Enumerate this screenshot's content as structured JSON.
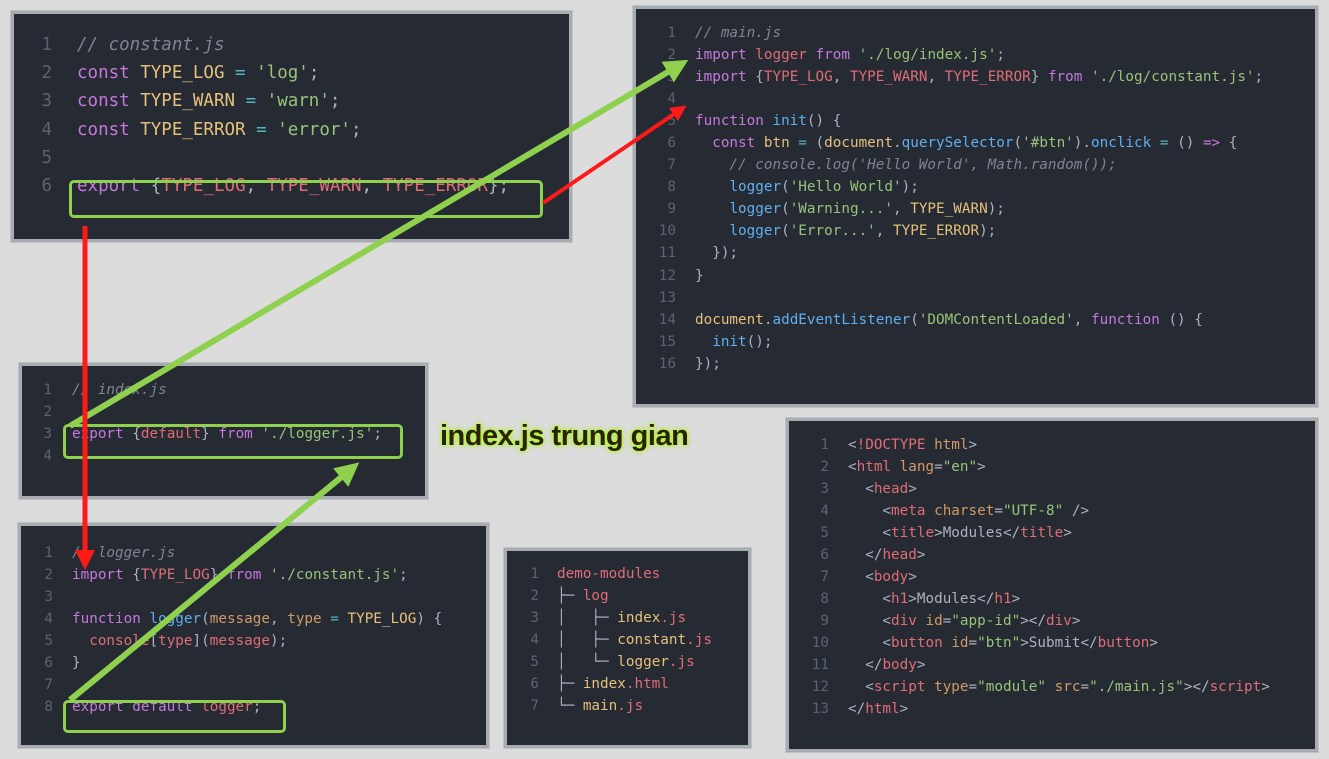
{
  "caption": "index.js trung gian",
  "colors": {
    "highlight": "#8fd14f",
    "green_arrow": "#8fd14f",
    "red_arrow": "#ff1a1a"
  },
  "constant_panel": {
    "lines": [
      [
        [
          "cm",
          "// constant.js"
        ]
      ],
      [
        [
          "kw",
          "const "
        ],
        [
          "var",
          "TYPE_LOG"
        ],
        [
          "op",
          " = "
        ],
        [
          "str",
          "'log'"
        ],
        [
          "pl",
          ";"
        ]
      ],
      [
        [
          "kw",
          "const "
        ],
        [
          "var",
          "TYPE_WARN"
        ],
        [
          "op",
          " = "
        ],
        [
          "str",
          "'warn'"
        ],
        [
          "pl",
          ";"
        ]
      ],
      [
        [
          "kw",
          "const "
        ],
        [
          "var",
          "TYPE_ERROR"
        ],
        [
          "op",
          " = "
        ],
        [
          "str",
          "'error'"
        ],
        [
          "pl",
          ";"
        ]
      ],
      [],
      [
        [
          "kw",
          "export "
        ],
        [
          "pl",
          "{"
        ],
        [
          "red",
          "TYPE_LOG"
        ],
        [
          "pl",
          ", "
        ],
        [
          "red",
          "TYPE_WARN"
        ],
        [
          "pl",
          ", "
        ],
        [
          "red",
          "TYPE_ERROR"
        ],
        [
          "pl",
          "};"
        ]
      ]
    ]
  },
  "main_panel": {
    "lines": [
      [
        [
          "cm",
          "// main.js"
        ]
      ],
      [
        [
          "kw",
          "import "
        ],
        [
          "red",
          "logger "
        ],
        [
          "kw",
          "from "
        ],
        [
          "str",
          "'./log/index.js'"
        ],
        [
          "pl",
          ";"
        ]
      ],
      [
        [
          "kw",
          "import "
        ],
        [
          "pl",
          "{"
        ],
        [
          "red",
          "TYPE_LOG"
        ],
        [
          "pl",
          ", "
        ],
        [
          "red",
          "TYPE_WARN"
        ],
        [
          "pl",
          ", "
        ],
        [
          "red",
          "TYPE_ERROR"
        ],
        [
          "pl",
          "} "
        ],
        [
          "kw",
          "from "
        ],
        [
          "str",
          "'./log/constant.js'"
        ],
        [
          "pl",
          ";"
        ]
      ],
      [],
      [
        [
          "kw",
          "function "
        ],
        [
          "fn",
          "init"
        ],
        [
          "pl",
          "() {"
        ]
      ],
      [
        [
          "pl",
          "  "
        ],
        [
          "kw",
          "const "
        ],
        [
          "var",
          "btn"
        ],
        [
          "op",
          " = "
        ],
        [
          "pl",
          "("
        ],
        [
          "var",
          "document"
        ],
        [
          "pl",
          "."
        ],
        [
          "fn",
          "querySelector"
        ],
        [
          "pl",
          "("
        ],
        [
          "str",
          "'#btn'"
        ],
        [
          "pl",
          ")."
        ],
        [
          "fn",
          "onclick"
        ],
        [
          "op",
          " = "
        ],
        [
          "pl",
          "() "
        ],
        [
          "kw",
          "=>"
        ],
        [
          "pl",
          " {"
        ]
      ],
      [
        [
          "cm",
          "    // console.log('Hello World', Math.random());"
        ]
      ],
      [
        [
          "pl",
          "    "
        ],
        [
          "fn",
          "logger"
        ],
        [
          "pl",
          "("
        ],
        [
          "str",
          "'Hello World'"
        ],
        [
          "pl",
          ");"
        ]
      ],
      [
        [
          "pl",
          "    "
        ],
        [
          "fn",
          "logger"
        ],
        [
          "pl",
          "("
        ],
        [
          "str",
          "'Warning...'"
        ],
        [
          "pl",
          ", "
        ],
        [
          "var",
          "TYPE_WARN"
        ],
        [
          "pl",
          ");"
        ]
      ],
      [
        [
          "pl",
          "    "
        ],
        [
          "fn",
          "logger"
        ],
        [
          "pl",
          "("
        ],
        [
          "str",
          "'Error...'"
        ],
        [
          "pl",
          ", "
        ],
        [
          "var",
          "TYPE_ERROR"
        ],
        [
          "pl",
          ");"
        ]
      ],
      [
        [
          "pl",
          "  });"
        ]
      ],
      [
        [
          "pl",
          "}"
        ]
      ],
      [],
      [
        [
          "var",
          "document"
        ],
        [
          "pl",
          "."
        ],
        [
          "fn",
          "addEventListener"
        ],
        [
          "pl",
          "("
        ],
        [
          "str",
          "'DOMContentLoaded'"
        ],
        [
          "pl",
          ", "
        ],
        [
          "kw",
          "function "
        ],
        [
          "pl",
          "() {"
        ]
      ],
      [
        [
          "pl",
          "  "
        ],
        [
          "fn",
          "init"
        ],
        [
          "pl",
          "();"
        ]
      ],
      [
        [
          "pl",
          "});"
        ]
      ]
    ]
  },
  "index_panel": {
    "lines": [
      [
        [
          "cm",
          "// index.js"
        ]
      ],
      [],
      [
        [
          "kw",
          "export "
        ],
        [
          "pl",
          "{"
        ],
        [
          "red",
          "default"
        ],
        [
          "pl",
          "} "
        ],
        [
          "kw",
          "from "
        ],
        [
          "str",
          "'./logger.js'"
        ],
        [
          "pl",
          ";"
        ]
      ],
      []
    ]
  },
  "logger_panel": {
    "lines": [
      [
        [
          "cm",
          "// logger.js"
        ]
      ],
      [
        [
          "kw",
          "import "
        ],
        [
          "pl",
          "{"
        ],
        [
          "red",
          "TYPE_LOG"
        ],
        [
          "pl",
          "} "
        ],
        [
          "kw",
          "from "
        ],
        [
          "str",
          "'./constant.js'"
        ],
        [
          "pl",
          ";"
        ]
      ],
      [],
      [
        [
          "kw",
          "function "
        ],
        [
          "fn",
          "logger"
        ],
        [
          "pl",
          "("
        ],
        [
          "attr",
          "message"
        ],
        [
          "pl",
          ", "
        ],
        [
          "attr",
          "type"
        ],
        [
          "op",
          " = "
        ],
        [
          "var",
          "TYPE_LOG"
        ],
        [
          "pl",
          ") {"
        ]
      ],
      [
        [
          "pl",
          "  "
        ],
        [
          "red",
          "console"
        ],
        [
          "pl",
          "["
        ],
        [
          "red",
          "type"
        ],
        [
          "pl",
          "]("
        ],
        [
          "red",
          "message"
        ],
        [
          "pl",
          ");"
        ]
      ],
      [
        [
          "pl",
          "}"
        ]
      ],
      [],
      [
        [
          "kw",
          "export default "
        ],
        [
          "red",
          "logger"
        ],
        [
          "pl",
          ";"
        ]
      ]
    ]
  },
  "tree_panel": {
    "lines": [
      [
        [
          "red",
          "demo-modules"
        ]
      ],
      [
        [
          "pl",
          "├─ "
        ],
        [
          "red",
          "log"
        ]
      ],
      [
        [
          "pl",
          "│   ├─ "
        ],
        [
          "var",
          "index"
        ],
        [
          "red",
          ".js"
        ]
      ],
      [
        [
          "pl",
          "│   ├─ "
        ],
        [
          "var",
          "constant"
        ],
        [
          "red",
          ".js"
        ]
      ],
      [
        [
          "pl",
          "│   └─ "
        ],
        [
          "var",
          "logger"
        ],
        [
          "red",
          ".js"
        ]
      ],
      [
        [
          "pl",
          "├─ "
        ],
        [
          "var",
          "index"
        ],
        [
          "red",
          ".html"
        ]
      ],
      [
        [
          "pl",
          "└─ "
        ],
        [
          "var",
          "main"
        ],
        [
          "red",
          ".js"
        ]
      ]
    ]
  },
  "html_panel": {
    "lines": [
      [
        [
          "pl",
          "<"
        ],
        [
          "tag",
          "!DOCTYPE "
        ],
        [
          "attr",
          "html"
        ],
        [
          "pl",
          ">"
        ]
      ],
      [
        [
          "pl",
          "<"
        ],
        [
          "tag",
          "html "
        ],
        [
          "attr",
          "lang"
        ],
        [
          "pl",
          "="
        ],
        [
          "str",
          "\"en\""
        ],
        [
          "pl",
          ">"
        ]
      ],
      [
        [
          "pl",
          "  <"
        ],
        [
          "tag",
          "head"
        ],
        [
          "pl",
          ">"
        ]
      ],
      [
        [
          "pl",
          "    <"
        ],
        [
          "tag",
          "meta "
        ],
        [
          "attr",
          "charset"
        ],
        [
          "pl",
          "="
        ],
        [
          "str",
          "\"UTF-8\""
        ],
        [
          "pl",
          " />"
        ]
      ],
      [
        [
          "pl",
          "    <"
        ],
        [
          "tag",
          "title"
        ],
        [
          "pl",
          ">Modules</"
        ],
        [
          "tag",
          "title"
        ],
        [
          "pl",
          ">"
        ]
      ],
      [
        [
          "pl",
          "  </"
        ],
        [
          "tag",
          "head"
        ],
        [
          "pl",
          ">"
        ]
      ],
      [
        [
          "pl",
          "  <"
        ],
        [
          "tag",
          "body"
        ],
        [
          "pl",
          ">"
        ]
      ],
      [
        [
          "pl",
          "    <"
        ],
        [
          "tag",
          "h1"
        ],
        [
          "pl",
          ">Modules</"
        ],
        [
          "tag",
          "h1"
        ],
        [
          "pl",
          ">"
        ]
      ],
      [
        [
          "pl",
          "    <"
        ],
        [
          "tag",
          "div "
        ],
        [
          "attr",
          "id"
        ],
        [
          "pl",
          "="
        ],
        [
          "str",
          "\"app-id\""
        ],
        [
          "pl",
          "></"
        ],
        [
          "tag",
          "div"
        ],
        [
          "pl",
          ">"
        ]
      ],
      [
        [
          "pl",
          "    <"
        ],
        [
          "tag",
          "button "
        ],
        [
          "attr",
          "id"
        ],
        [
          "pl",
          "="
        ],
        [
          "str",
          "\"btn\""
        ],
        [
          "pl",
          ">Submit</"
        ],
        [
          "tag",
          "button"
        ],
        [
          "pl",
          ">"
        ]
      ],
      [
        [
          "pl",
          "  </"
        ],
        [
          "tag",
          "body"
        ],
        [
          "pl",
          ">"
        ]
      ],
      [
        [
          "pl",
          "  <"
        ],
        [
          "tag",
          "script "
        ],
        [
          "attr",
          "type"
        ],
        [
          "pl",
          "="
        ],
        [
          "str",
          "\"module\""
        ],
        [
          "pl",
          " "
        ],
        [
          "attr",
          "src"
        ],
        [
          "pl",
          "="
        ],
        [
          "str",
          "\"./main.js\""
        ],
        [
          "pl",
          "></"
        ],
        [
          "tag",
          "script"
        ],
        [
          "pl",
          ">"
        ]
      ],
      [
        [
          "pl",
          "</"
        ],
        [
          "tag",
          "html"
        ],
        [
          "pl",
          ">"
        ]
      ]
    ]
  }
}
